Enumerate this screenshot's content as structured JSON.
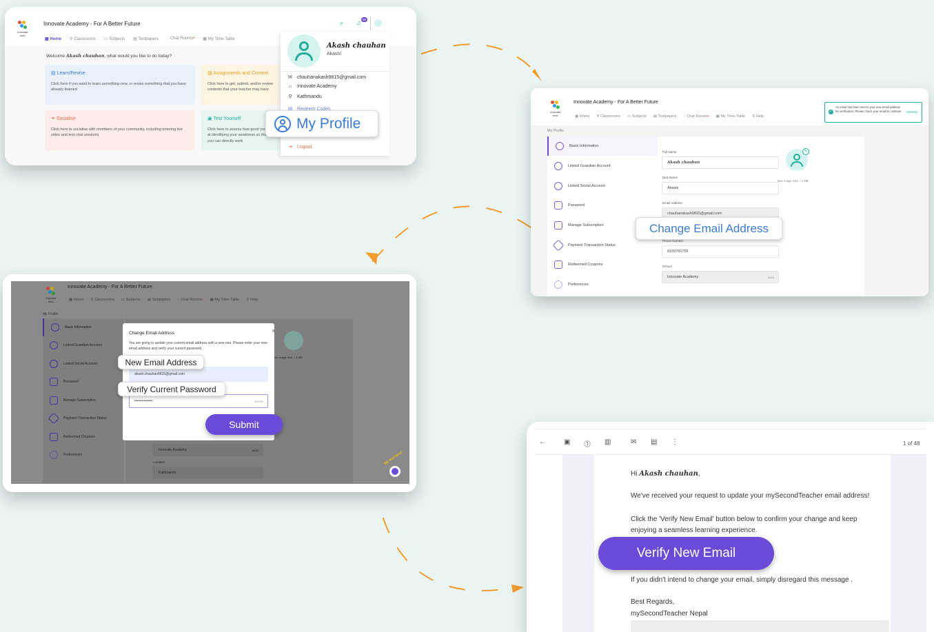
{
  "colors": {
    "background": "#eaf5f3",
    "accent": "#6a4bd8",
    "teal": "#1fae9a",
    "arrow": "#f39c2b"
  },
  "app": {
    "title": "Innovate Academy - For A Better Future",
    "logo_text": "Innovate tech"
  },
  "nav": {
    "home": "Home",
    "classrooms": "Classrooms",
    "subjects": "Subjects",
    "testpapers": "Testpapers",
    "chat_rooms": "Chat Rooms",
    "timetable1": "My Time-Table",
    "timetable2": "My Time-Table",
    "help": "Help"
  },
  "notif_count": "99",
  "home": {
    "welcome_pre": "Welcome ",
    "welcome_name": "Akash chauhan",
    "welcome_post": ", what would you like to do today?",
    "tiles": [
      {
        "title": "Learn/Revise",
        "desc": "Click here if you want to learn something new, or revise something that you have already learned"
      },
      {
        "title": "Assignments and Content",
        "desc": "Click here to get, submit, and/or review contents that your teacher may have"
      },
      {
        "title": "Socialise",
        "desc": "Click here to socialise with members of your community, including entering live video and text-chat sessions"
      },
      {
        "title": "Test Yourself",
        "desc": "Click here to assess how good you are at identifying your weakness so that you can directly work"
      }
    ]
  },
  "profile_menu": {
    "name": "Akash chauhan",
    "nick": "Akashi",
    "email": "chauhanakash9815@gmail.com",
    "school": "Innovate Academy",
    "location": "Kathmandu",
    "redeem": "Redeem Codes",
    "logout": "Logout"
  },
  "callouts": {
    "my_profile": "My Profile",
    "change_email": "Change Email Address",
    "new_email": "New Email Address",
    "verify_password": "Verify Current Password",
    "submit": "Submit",
    "verify_new_email": "Verify New Email"
  },
  "profile_page": {
    "breadcrumb": "My Profile",
    "sidebar": [
      "Basic Information",
      "Linked Guardian Account",
      "Linked Social Account",
      "Password",
      "Manage Subscription",
      "Payment Transaction Status",
      "Redeemed Coupons",
      "Preferences"
    ],
    "full_name_label": "Full Name",
    "full_name": "Akash chauhan",
    "nick_label": "Nick Name",
    "nick": "Akashi",
    "email_label": "Email Address",
    "email": "chauhanakash9815@gmail.com",
    "phone_label": "Phone Number",
    "phone": "8159781755",
    "school_label": "School",
    "school": "Innovate Academy",
    "school_count": "16/28",
    "location_label": "Location",
    "location": "Kathmandu",
    "max_image": "Max Image Size = 1 MB",
    "toast": "An email has been sent to your new email address for verification. Please check your email to continue",
    "toast_dismiss": "Dismiss"
  },
  "modal": {
    "title": "Change Email Address",
    "desc": "You are going to update your current email address with a new one. Please enter your new email address and verify your current password.",
    "new_email_value": "akash.chauhan9815@gmail.com",
    "password_value": "•••••••••••••••",
    "show": "SHOW",
    "chat_badge": "We Are Here!"
  },
  "email": {
    "count": "1 of 48",
    "greet_pre": "Hi ",
    "greet_name": "Akash chauhan",
    "greet_post": ",",
    "line1": "We've received your request to update your mySecondTeacher email address!",
    "line2": "Click the 'Verify New Email' button below to confirm your change and keep enjoying a seamless learning experience.",
    "line3": "If you didn't intend to change your email, simply disregard this message .",
    "sign1": "Best Regards,",
    "sign2": "mySecondTeacher Nepal"
  }
}
